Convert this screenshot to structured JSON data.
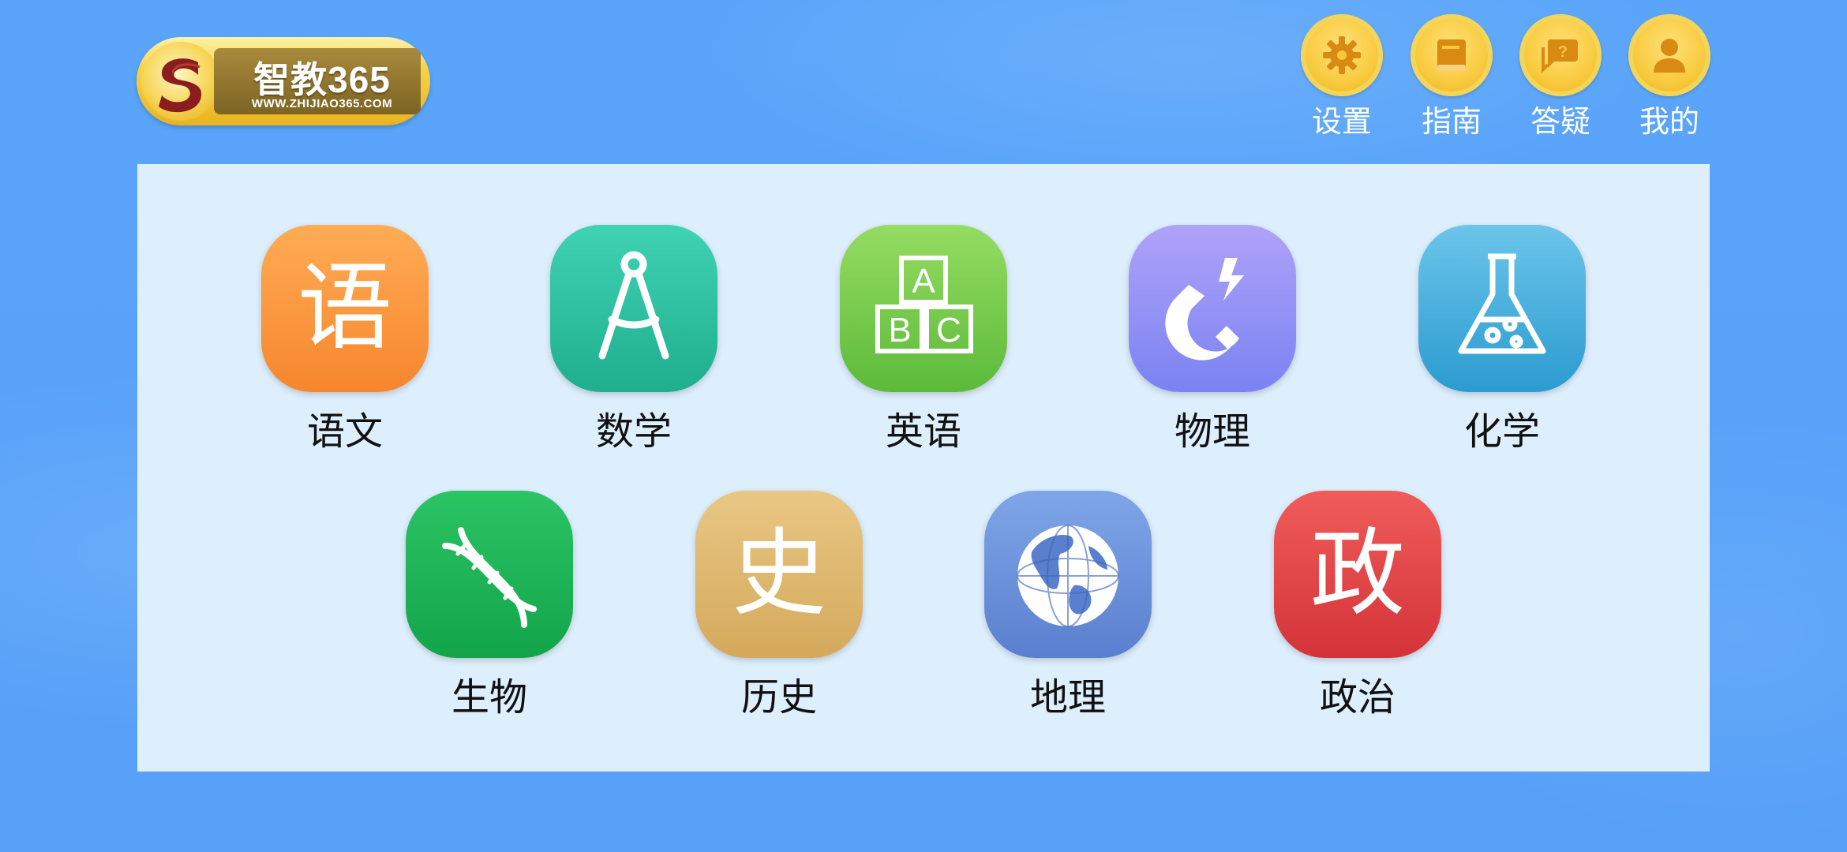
{
  "header": {
    "logo": {
      "title": "智教365",
      "subtitle": "WWW.ZHIJIAO365.COM"
    },
    "buttons": [
      {
        "label": "设置",
        "icon": "gear-icon"
      },
      {
        "label": "指南",
        "icon": "book-icon"
      },
      {
        "label": "答疑",
        "icon": "question-chat-icon"
      },
      {
        "label": "我的",
        "icon": "user-icon"
      }
    ]
  },
  "subjects": [
    {
      "label": "语文",
      "glyph": "语",
      "icon": "chinese-char-icon",
      "color": "#f6862d"
    },
    {
      "label": "数学",
      "icon": "compass-icon",
      "color": "#1fae8e"
    },
    {
      "label": "英语",
      "icon": "abc-blocks-icon",
      "color": "#5cba3a"
    },
    {
      "label": "物理",
      "icon": "magnet-icon",
      "color": "#7a83f2"
    },
    {
      "label": "化学",
      "icon": "flask-icon",
      "color": "#2b9bd0"
    },
    {
      "label": "生物",
      "icon": "dna-icon",
      "color": "#13a449"
    },
    {
      "label": "历史",
      "glyph": "史",
      "icon": "history-char-icon",
      "color": "#d4a95c"
    },
    {
      "label": "地理",
      "icon": "globe-icon",
      "color": "#5a7fcf"
    },
    {
      "label": "政治",
      "glyph": "政",
      "icon": "politics-char-icon",
      "color": "#d33338"
    }
  ],
  "abc_blocks": {
    "a": "A",
    "b": "B",
    "c": "C"
  }
}
